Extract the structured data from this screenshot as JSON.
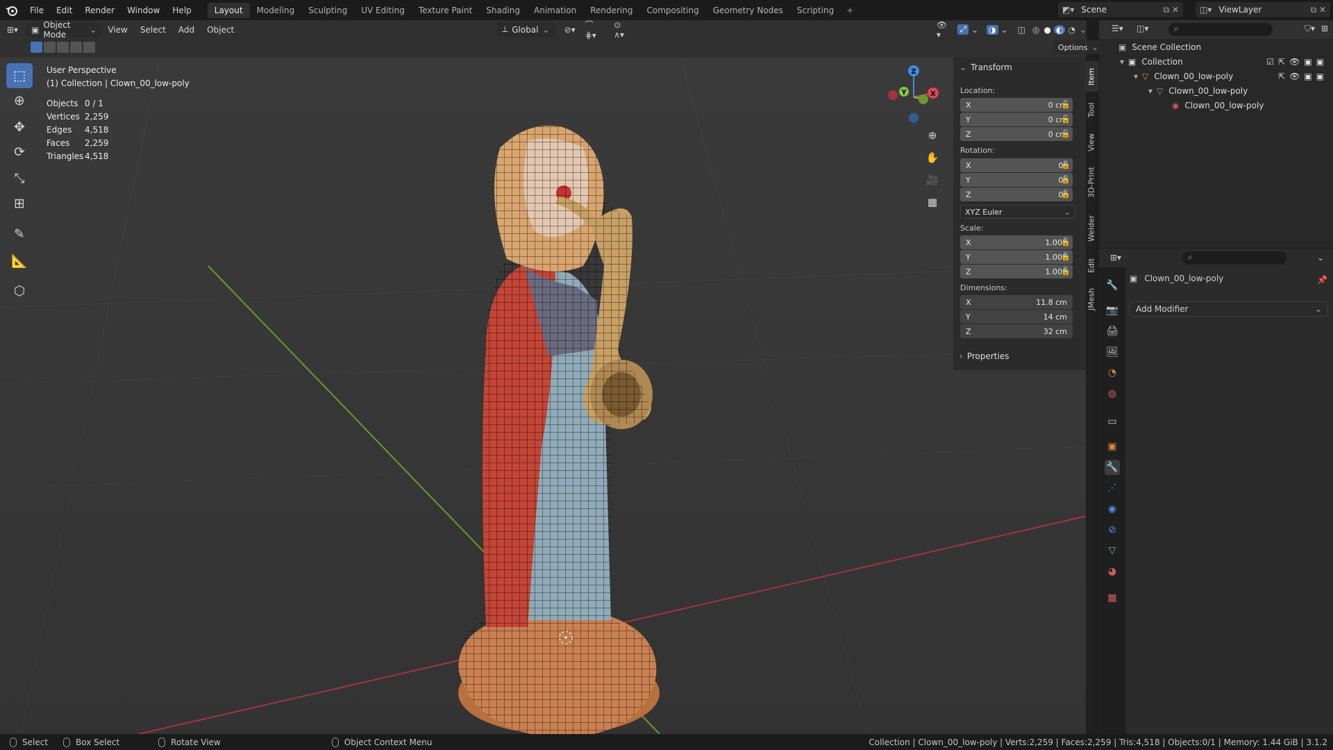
{
  "topbar": {
    "menu": [
      "File",
      "Edit",
      "Render",
      "Window",
      "Help"
    ],
    "workspaces": [
      "Layout",
      "Modeling",
      "Sculpting",
      "UV Editing",
      "Texture Paint",
      "Shading",
      "Animation",
      "Rendering",
      "Compositing",
      "Geometry Nodes",
      "Scripting"
    ],
    "active_workspace": "Layout",
    "scene": "Scene",
    "view_layer": "ViewLayer"
  },
  "header": {
    "mode": "Object Mode",
    "menus": [
      "View",
      "Select",
      "Add",
      "Object"
    ],
    "orientation": "Global",
    "options": "Options"
  },
  "overlay": {
    "perspective": "User Perspective",
    "collection": "(1) Collection | Clown_00_low-poly",
    "stats": [
      {
        "k": "Objects",
        "v": "0 / 1"
      },
      {
        "k": "Vertices",
        "v": "2,259"
      },
      {
        "k": "Edges",
        "v": "4,518"
      },
      {
        "k": "Faces",
        "v": "2,259"
      },
      {
        "k": "Triangles",
        "v": "4,518"
      }
    ]
  },
  "gizmo": {
    "z": "Z",
    "y": "Y",
    "x": "X"
  },
  "npanel": {
    "title": "Transform",
    "location_label": "Location:",
    "location": [
      {
        "a": "X",
        "v": "0 cm"
      },
      {
        "a": "Y",
        "v": "0 cm"
      },
      {
        "a": "Z",
        "v": "0 cm"
      }
    ],
    "rotation_label": "Rotation:",
    "rotation": [
      {
        "a": "X",
        "v": "0°"
      },
      {
        "a": "Y",
        "v": "0°"
      },
      {
        "a": "Z",
        "v": "0°"
      }
    ],
    "rotation_mode": "XYZ Euler",
    "scale_label": "Scale:",
    "scale": [
      {
        "a": "X",
        "v": "1.000"
      },
      {
        "a": "Y",
        "v": "1.000"
      },
      {
        "a": "Z",
        "v": "1.000"
      }
    ],
    "dimensions_label": "Dimensions:",
    "dimensions": [
      {
        "a": "X",
        "v": "11.8 cm"
      },
      {
        "a": "Y",
        "v": "14 cm"
      },
      {
        "a": "Z",
        "v": "32 cm"
      }
    ],
    "properties": "Properties",
    "tabs": [
      "Item",
      "Tool",
      "View",
      "3D-Print",
      "Welder",
      "Edit",
      "JMesh"
    ]
  },
  "outliner": {
    "scene_collection": "Scene Collection",
    "collection": "Collection",
    "object": "Clown_00_low-poly",
    "mesh": "Clown_00_low-poly",
    "material": "Clown_00_low-poly"
  },
  "properties": {
    "object_name": "Clown_00_low-poly",
    "add_modifier": "Add Modifier"
  },
  "statusbar": {
    "select": "Select",
    "box_select": "Box Select",
    "rotate_view": "Rotate View",
    "context_menu": "Object Context Menu",
    "info": "Collection | Clown_00_low-poly | Verts:2,259 | Faces:2,259 | Tris:4,518 | Objects:0/1 | Memory: 1.44 GiB | 3.1.2"
  },
  "colors": {
    "accent": "#4772b3",
    "axis_x": "#e0455b",
    "axis_y": "#8bc34a",
    "axis_z": "#3d8fe0",
    "clown_red": "#c44536",
    "clown_blue": "#8faab8",
    "sax_gold": "#c8a064",
    "base_orange": "#c98050"
  }
}
